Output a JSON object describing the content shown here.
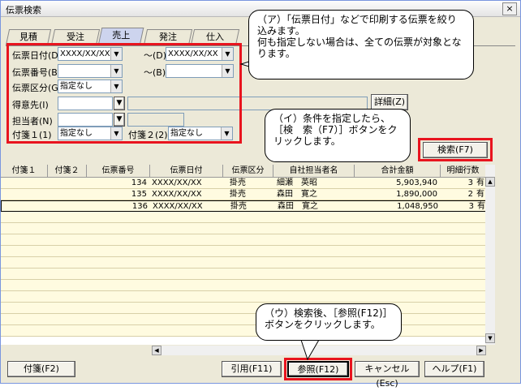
{
  "window": {
    "title": "伝票検索",
    "close_label": "×"
  },
  "tabs": [
    {
      "label": "見積"
    },
    {
      "label": "受注"
    },
    {
      "label": "売上"
    },
    {
      "label": "発注"
    },
    {
      "label": "仕入"
    }
  ],
  "filters": {
    "date_label": "伝票日付(D)",
    "date_from": "XXXX/XX/XX",
    "date_to_label": "～(D)",
    "date_to": "XXXX/XX/XX",
    "number_label": "伝票番号(B)",
    "number_to_label": "～(B)",
    "type_label": "伝票区分(G)",
    "type_value": "指定なし",
    "customer_label": "得意先(I)",
    "staff_label": "担当者(N)",
    "tag1_label": "付箋１(1)",
    "tag1_value": "指定なし",
    "tag2_label": "付箋２(2)",
    "tag2_value": "指定なし",
    "detail_button": "詳細(Z)",
    "search_button": "検索(F7)"
  },
  "callouts": {
    "a": "（ア）「伝票日付」などで印刷する伝票を絞り込みます。\n何も指定しない場合は、全ての伝票が対象となります。",
    "b": "（イ）条件を指定したら、［検　索（F7）］ボタンをクリックします。",
    "c": "（ウ）検索後、［参照(F12)］ボタンをクリックします。"
  },
  "table": {
    "headers": [
      "付箋１",
      "付箋２",
      "伝票番号",
      "伝票日付",
      "伝票区分",
      "自社担当者名",
      "合計金額",
      "明細行数"
    ],
    "rows": [
      {
        "no": "134",
        "date": "XXXX/XX/XX",
        "type": "掛売",
        "staff": "細瀬　英昭",
        "total": "5,903,940",
        "lines": "3",
        "extra": "有"
      },
      {
        "no": "135",
        "date": "XXXX/XX/XX",
        "type": "掛売",
        "staff": "森田　寛之",
        "total": "1,890,000",
        "lines": "2",
        "extra": "有"
      },
      {
        "no": "136",
        "date": "XXXX/XX/XX",
        "type": "掛売",
        "staff": "森田　寛之",
        "total": "1,048,950",
        "lines": "3",
        "extra": "有"
      }
    ]
  },
  "footer": {
    "tag_button": "付箋(F2)",
    "quote_button": "引用(F11)",
    "ref_button": "参照(F12)",
    "cancel_button": "キャンセル(Esc)",
    "help_button": "ヘルプ(F1)"
  }
}
